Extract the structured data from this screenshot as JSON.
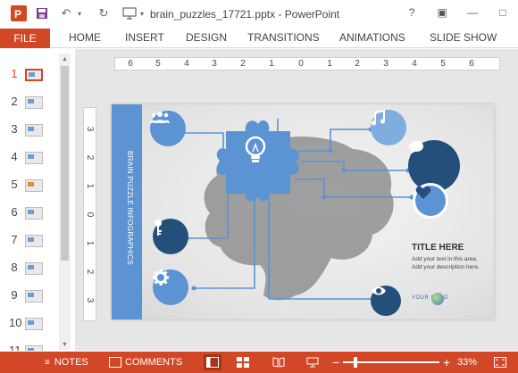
{
  "window": {
    "title": "brain_puzzles_17721.pptx - PowerPoint",
    "controls": [
      "?",
      "▣",
      "—",
      "□"
    ]
  },
  "ribbon": {
    "file": "FILE",
    "tabs": [
      "HOME",
      "INSERT",
      "DESIGN",
      "TRANSITIONS",
      "ANIMATIONS",
      "SLIDE SHOW"
    ]
  },
  "thumbnails": {
    "numbers": [
      "1",
      "2",
      "3",
      "4",
      "5",
      "6",
      "7",
      "8",
      "9",
      "10",
      "11"
    ],
    "active_index": 0
  },
  "ruler": {
    "horizontal": [
      "6",
      "5",
      "4",
      "3",
      "2",
      "1",
      "0",
      "1",
      "2",
      "3",
      "4",
      "5",
      "6"
    ],
    "vertical": [
      "3",
      "2",
      "1",
      "0",
      "1",
      "2",
      "3"
    ]
  },
  "slide": {
    "sidebar_title": "BRAIN PUZZLE INFOGRAPHICS",
    "heading": "TITLE HERE",
    "description": "Add your text in this area. Add your description here.",
    "logo_text": "YOUR LOGO",
    "colors": {
      "light_blue": "#5b93d3",
      "dark_navy": "#244f7a",
      "brain_gray": "#8f8f8f"
    },
    "icons": [
      "people-icon",
      "lightbulb-icon",
      "music-note-icon",
      "chat-bubble-icon",
      "heart-icon",
      "key-icon",
      "gear-icon",
      "eye-icon"
    ]
  },
  "statusbar": {
    "notes": "NOTES",
    "comments": "COMMENTS",
    "zoom": "33%",
    "zoom_minus": "−",
    "zoom_plus": "+"
  }
}
